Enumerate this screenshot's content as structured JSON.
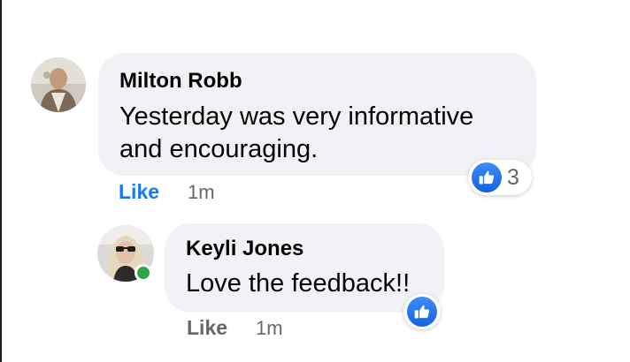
{
  "colors": {
    "bubble_bg": "#f0f2f5",
    "like_blue": "#1877f2",
    "secondary_text": "#65676b",
    "online_green": "#31a24c"
  },
  "comments": [
    {
      "author": "Milton Robb",
      "text": "Yesterday was very informative and encouraging.",
      "reaction_icon": "thumbs-up-icon",
      "reaction_count": "3",
      "like_label": "Like",
      "time": "1m"
    },
    {
      "author": "Keyli Jones",
      "text": "Love the feedback!!",
      "reaction_icon": "thumbs-up-icon",
      "like_label": "Like",
      "time": "1m",
      "online": true
    }
  ]
}
